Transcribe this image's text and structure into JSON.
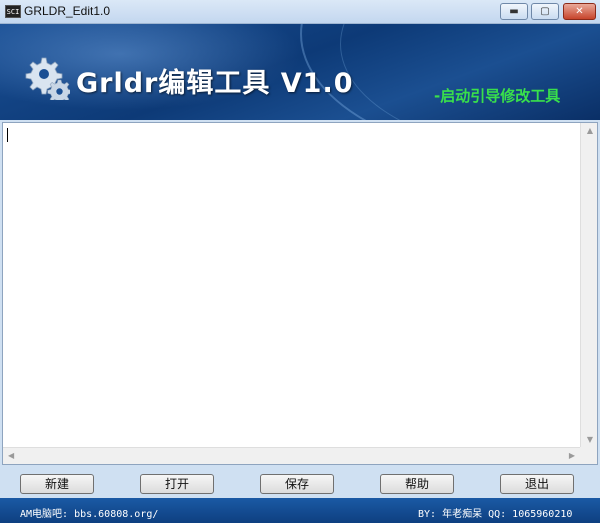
{
  "window": {
    "app_icon_text": "SCI",
    "title": "GRLDR_Edit1.0",
    "min_glyph": "▬",
    "max_glyph": "▢",
    "close_glyph": "✕"
  },
  "banner": {
    "title": "Grldr编辑工具 V1.0",
    "subtitle": "-启动引导修改工具",
    "icon": "gear-icon"
  },
  "editor": {
    "content": ""
  },
  "buttons": {
    "new": "新建",
    "open": "打开",
    "save": "保存",
    "help": "帮助",
    "exit": "退出"
  },
  "status": {
    "left": "AM电脑吧: bbs.60808.org/",
    "right": "BY: 年老痴呆 QQ: 1065960210"
  },
  "colors": {
    "banner_blue": "#0d3a77",
    "subtitle_green": "#39e04b",
    "status_blue": "#1a5aa5"
  }
}
